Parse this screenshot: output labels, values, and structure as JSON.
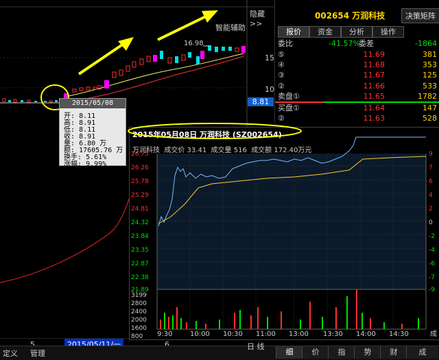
{
  "kline": {
    "hide_label": "隐藏>>",
    "assist_label": "智能辅助",
    "high_marker": "16.98",
    "scale_right": [
      "15",
      "10"
    ],
    "current_price": "8.81",
    "axis_bottom_left": "5",
    "axis_bottom_date": "2015/05/11/一",
    "axis_bottom_right": "6"
  },
  "popup": {
    "date": "2015/05/08",
    "rows": [
      {
        "label": "开:",
        "value": "8.11"
      },
      {
        "label": "高:",
        "value": "8.91"
      },
      {
        "label": "低:",
        "value": "8.11"
      },
      {
        "label": "收:",
        "value": "8.91"
      },
      {
        "label": "量:",
        "value": "6.80 万"
      },
      {
        "label": "额:",
        "value": "17605.76 万"
      },
      {
        "label": "换手:",
        "value": "5.61%"
      },
      {
        "label": "涨幅:",
        "value": "9.99%"
      }
    ]
  },
  "right_panel": {
    "stock_code": "002654",
    "stock_name": "万润科技",
    "decision_button": "决策矩阵",
    "tabs": [
      "报价",
      "资金",
      "分析",
      "操作"
    ],
    "ratio_label": "委比",
    "ratio_value": "-41.57%",
    "diff_label": "委差",
    "diff_value": "-1864",
    "sell_orders": [
      {
        "label": "⑤",
        "price": "11.69",
        "vol": "381"
      },
      {
        "label": "④",
        "price": "11.68",
        "vol": "353"
      },
      {
        "label": "③",
        "price": "11.67",
        "vol": "125"
      },
      {
        "label": "②",
        "price": "11.66",
        "vol": "533"
      },
      {
        "label": "卖盘①",
        "price": "11.65",
        "vol": "1782"
      }
    ],
    "buy_orders": [
      {
        "label": "买盘①",
        "price": "11.64",
        "vol": "147"
      },
      {
        "label": "②",
        "price": "11.63",
        "vol": "528"
      }
    ]
  },
  "intraday": {
    "title": "2015年05月08日  万润科技 (SZ002654)",
    "name": "万润科技",
    "price_label": "成交价",
    "price_value": "33.41",
    "vol_label": "成交量",
    "vol_value": "516",
    "amt_label": "成交额",
    "amt_value": "172.40万元",
    "left_axis": [
      "26.75",
      "26.26",
      "25.78",
      "25.29",
      "24.81",
      "24.32",
      "23.84",
      "23.35",
      "22.87",
      "22.38",
      "21.89"
    ],
    "right_axis": [
      "9",
      "7",
      "6",
      "4",
      "2",
      "0",
      "-2",
      "-4",
      "-6",
      "-7",
      "-9"
    ],
    "vol_axis": [
      "3199",
      "2800",
      "2400",
      "2000",
      "1600",
      "800"
    ],
    "time_axis": [
      "9:30",
      "10:00",
      "10:30",
      "11:00",
      "13:00",
      "13:30",
      "14:00",
      "14:30"
    ],
    "vol_right_partial": "成"
  },
  "bottom": {
    "left_tabs": [
      "定义",
      "管理"
    ],
    "partial_tab": "日 线",
    "right_tabs": [
      "细",
      "价",
      "指",
      "势",
      "财",
      "成"
    ]
  },
  "colors": {
    "up": "#ff3030",
    "down": "#00e000",
    "highlight": "#ffd700",
    "magenta": "#ff00ff",
    "cyan": "#00ffff",
    "price_line": "#7fb8ff",
    "avg_line": "#ffcc33"
  }
}
